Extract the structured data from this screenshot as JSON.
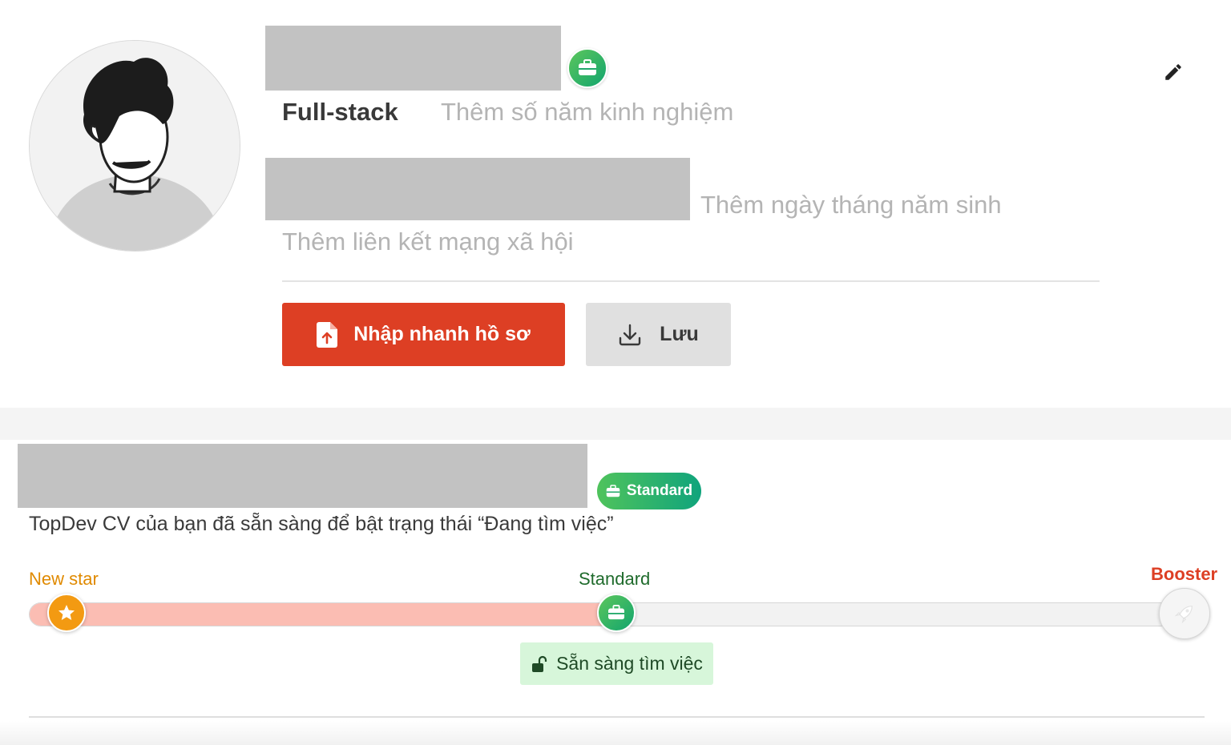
{
  "profile": {
    "role": "Full-stack",
    "years_placeholder": "Thêm số năm kinh nghiệm",
    "dob_placeholder": "Thêm ngày tháng năm sinh",
    "social_placeholder": "Thêm liên kết mạng xã hội"
  },
  "actions": {
    "import_label": "Nhập nhanh hồ sơ",
    "save_label": "Lưu"
  },
  "status": {
    "badge_label": "Standard",
    "description": "TopDev CV của bạn đã sẵn sàng để bật trạng thái “Đang tìm việc”",
    "levels": [
      "New star",
      "Standard",
      "Booster"
    ],
    "progress_percent": 50,
    "ready_label": "Sẵn sàng tìm việc"
  },
  "colors": {
    "accent_red": "#dd3f24",
    "green": "#12a56e",
    "orange": "#f39a12",
    "progress_fill": "#fbbdb3"
  },
  "icons": {
    "edit": "pencil-icon",
    "import": "file-upload-icon",
    "save": "download-icon",
    "badge": "briefcase-icon",
    "star": "star-icon",
    "booster": "rocket-icon",
    "ready": "unlock-icon"
  }
}
